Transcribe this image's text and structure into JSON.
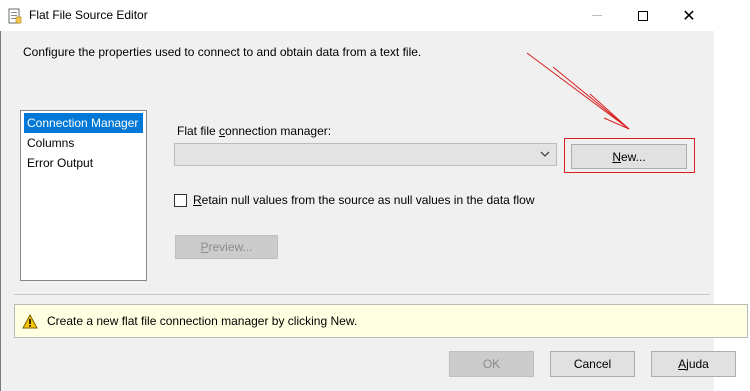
{
  "window": {
    "title": "Flat File Source Editor",
    "description": "Configure the properties used to connect to and obtain data from a text file."
  },
  "nav": {
    "items": [
      {
        "label": "Connection Manager",
        "selected": true
      },
      {
        "label": "Columns",
        "selected": false
      },
      {
        "label": "Error Output",
        "selected": false
      }
    ]
  },
  "connection": {
    "label_pre": "Flat file ",
    "label_key": "c",
    "label_post": "onnection manager:",
    "selected_value": "",
    "new_key": "N",
    "new_rest": "ew..."
  },
  "options": {
    "retain_key": "R",
    "retain_rest": "etain null values from the source as null values in the data flow",
    "retain_checked": false,
    "preview_key": "P",
    "preview_rest": "review..."
  },
  "info": {
    "message": "Create a new flat file connection manager by clicking New."
  },
  "footer": {
    "ok_label": "OK",
    "cancel_label": "Cancel",
    "help_key": "A",
    "help_rest": "juda"
  },
  "colors": {
    "selection": "#0078d7",
    "highlight_border": "#d81e1e",
    "info_background": "#ffffe1"
  }
}
